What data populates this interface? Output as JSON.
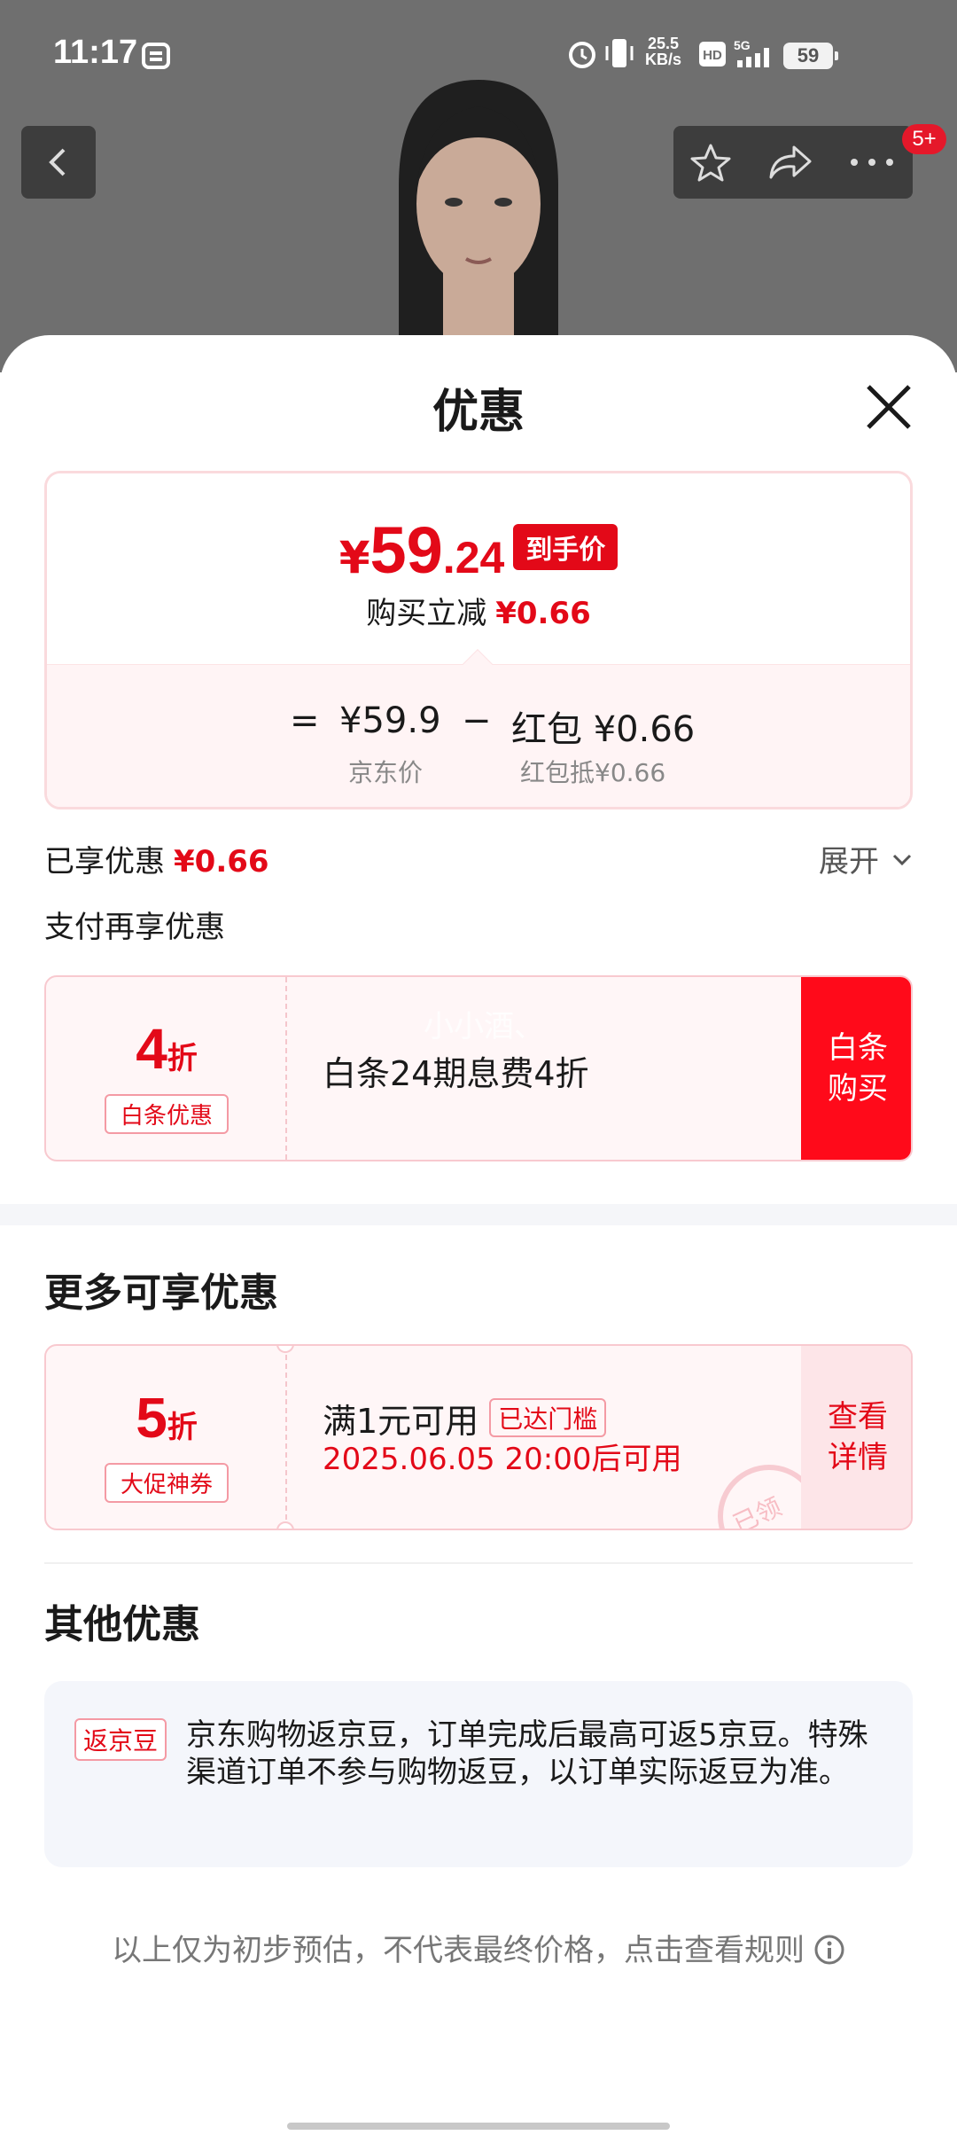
{
  "status_bar": {
    "time": "11:17",
    "net_speed_value": "25.5",
    "net_speed_unit": "KB/s",
    "battery": "59"
  },
  "nav": {
    "badge": "5+"
  },
  "sheet": {
    "title": "优惠"
  },
  "price_card": {
    "yen": "¥",
    "price_int": "59",
    "price_dec": ".24",
    "price_tag": "到手价",
    "reduction_label": "购买立减",
    "reduction_value": "¥0.66",
    "calc": {
      "eq": "=",
      "jd_price": "¥59.9",
      "minus": "−",
      "redpacket": "红包 ¥0.66",
      "jd_price_label": "京东价",
      "redpacket_label": "红包抵¥0.66"
    }
  },
  "enjoyed": {
    "label": "已享优惠",
    "value": "¥0.66",
    "expand": "展开"
  },
  "pay_more": "支付再享优惠",
  "coupon_baitiao": {
    "discount_num": "4",
    "discount_unit": "折",
    "tag": "白条优惠",
    "watermark": "小小酒、",
    "text": "白条24期息费4折",
    "button": "白条\n购买"
  },
  "more_section": {
    "title": "更多可享优惠"
  },
  "coupon_promo": {
    "discount_num": "5",
    "discount_unit": "折",
    "tag": "大促神券",
    "text": "满1元可用",
    "reached": "已达门槛",
    "time": "2025.06.05 20:00后可用",
    "stamp": "已领",
    "button": "查看\n详情"
  },
  "other_section": {
    "title": "其他优惠",
    "tag": "返京豆",
    "text": "京东购物返京豆，订单完成后最高可返5京豆。特殊渠道订单不参与购物返豆，以订单实际返豆为准。"
  },
  "footer": {
    "note": "以上仅为初步预估，不代表最终价格，点击查看规则"
  },
  "colors": {
    "accent_red": "#e30918",
    "button_red": "#ff0a1a",
    "pink_bg": "#fff6f7"
  }
}
